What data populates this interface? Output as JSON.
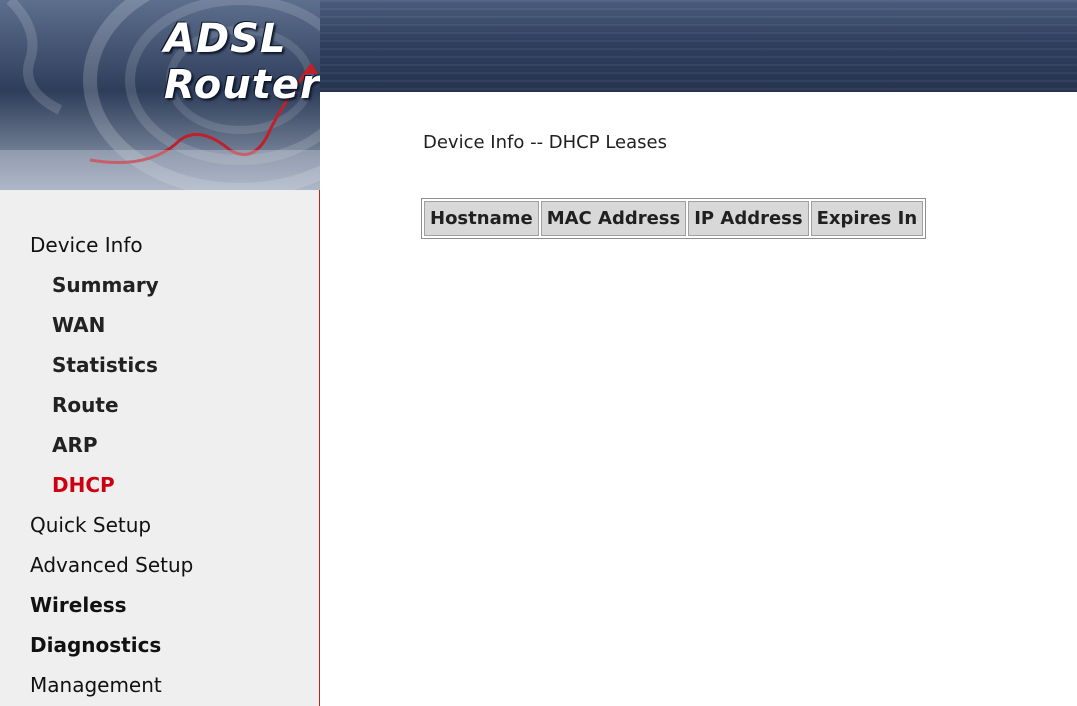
{
  "header": {
    "brand": "ADSL Router",
    "colors": {
      "header_dark": "#26344f",
      "accent_red": "#cc0011"
    }
  },
  "main": {
    "title": "Device Info -- DHCP Leases",
    "table_headers": [
      "Hostname",
      "MAC Address",
      "IP Address",
      "Expires In"
    ]
  },
  "sidebar": {
    "items": [
      {
        "label": "Device Info",
        "level": 0
      },
      {
        "label": "Summary",
        "level": 1
      },
      {
        "label": "WAN",
        "level": 1
      },
      {
        "label": "Statistics",
        "level": 1
      },
      {
        "label": "Route",
        "level": 1
      },
      {
        "label": "ARP",
        "level": 1
      },
      {
        "label": "DHCP",
        "level": 1,
        "active": true
      },
      {
        "label": "Quick Setup",
        "level": 0
      },
      {
        "label": "Advanced Setup",
        "level": 0
      },
      {
        "label": "Wireless",
        "level": 0
      },
      {
        "label": "Diagnostics",
        "level": 0
      },
      {
        "label": "Management",
        "level": 0
      }
    ]
  }
}
